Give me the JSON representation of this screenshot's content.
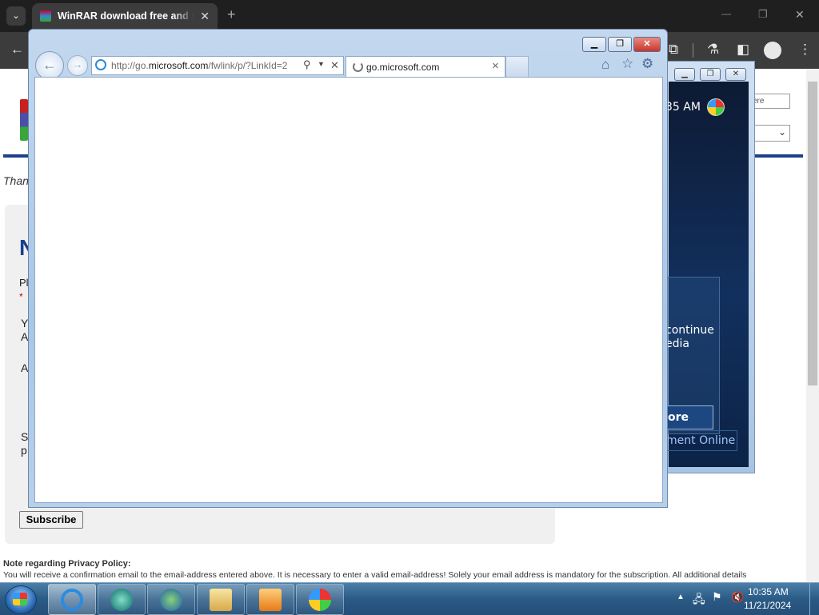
{
  "chrome": {
    "tab_title": "WinRAR download free and support: WinRAR",
    "tab_close": "✕",
    "new_tab": "+",
    "window_controls": {
      "minimize": "—",
      "restore": "❐",
      "close": "✕"
    }
  },
  "page": {
    "partial_letters": {
      "thank": "Than",
      "heading": "N",
      "p1": "Pl",
      "star": "*",
      "y": "Y",
      "a1": "A",
      "a2": "A",
      "s": "S",
      "p2": "p"
    },
    "subscribe_button": "Subscribe",
    "note_title": "Note regarding Privacy Policy:",
    "note_body": "You will receive a confirmation email to the email-address entered above. It is necessary to enter a valid email-address! Solely your email address is mandatory for the subscription. All additional details",
    "search_fragment": "ere"
  },
  "background_window": {
    "time": "35 AM",
    "line1": "continue",
    "line2": "edia",
    "button": "ore",
    "link": "ment Online"
  },
  "ie": {
    "url_prefix": "http://go.",
    "url_domain": "microsoft.com",
    "url_suffix": "/fwlink/p/?LinkId=2",
    "tab_title": "go.microsoft.com",
    "tab_close": "×",
    "address_close": "✕"
  },
  "taskbar": {
    "time": "10:35 AM",
    "date": "11/21/2024"
  },
  "colors": {
    "accent_blue": "#1c3f8f",
    "taskbar": "#2a5a86",
    "ie_frame": "#b7d0ea",
    "ie_close": "#c8362c"
  }
}
